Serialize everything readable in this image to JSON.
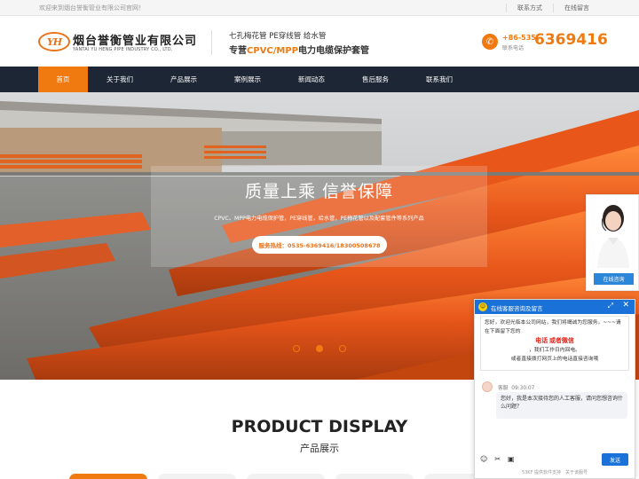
{
  "topbar": {
    "welcome": "欢迎来到烟台誉衡管业有限公司官网！",
    "links": [
      "联系方式",
      "在线留言"
    ]
  },
  "header": {
    "logo_mark": "YH",
    "company_cn": "烟台誉衡管业有限公司",
    "company_en": "YANTAI YU HENG PIPE INDUSTRY CO., LTD.",
    "slogan_line1": "七孔梅花管 PE穿线管 给水管",
    "slogan_line2_prefix": "专营",
    "slogan_line2_highlight": "CPVC/MPP",
    "slogan_line2_suffix": "电力电缆保护套管",
    "phone_code": "+86-535",
    "phone_label": "联系电话",
    "phone_number": "6369416",
    "accent_color": "#f07a10"
  },
  "nav": {
    "items": [
      "首页",
      "关于我们",
      "产品展示",
      "案例展示",
      "新闻动态",
      "售后服务",
      "联系我们"
    ],
    "active_index": 0
  },
  "hero": {
    "title": "质量上乘 信誉保障",
    "subtitle": "CPVC、MPP电力电缆保护管，PE穿线管，给水管，PE梅花管以及配套管件等系列产品",
    "hotline": "服务热线：0535-6369416/18300508678",
    "slide_count": 3,
    "active_slide": 1
  },
  "products": {
    "title_en": "PRODUCT DISPLAY",
    "title_cn": "产品展示"
  },
  "float_card": {
    "button_label": "在线咨询"
  },
  "chat": {
    "header_title": "在线客服咨询及留言",
    "notice_line1": "您好，欢迎光临本公司网站，我们将竭诚为您服务，~~~请在下面留下您的",
    "notice_red1": "电话",
    "notice_mid": "或者",
    "notice_red2": "微信",
    "notice_line2": "，我们工作日内回电。",
    "notice_line3": "或者直接拨打网页上的电话直接咨询哦",
    "agent_name": "客服",
    "agent_time": "09:30:07",
    "message": "您好，我是本次接待您的人工客服，请问您想咨询什么问题？",
    "send_label": "发送",
    "footer": "53KF 提供软件支持　关于该服号"
  }
}
